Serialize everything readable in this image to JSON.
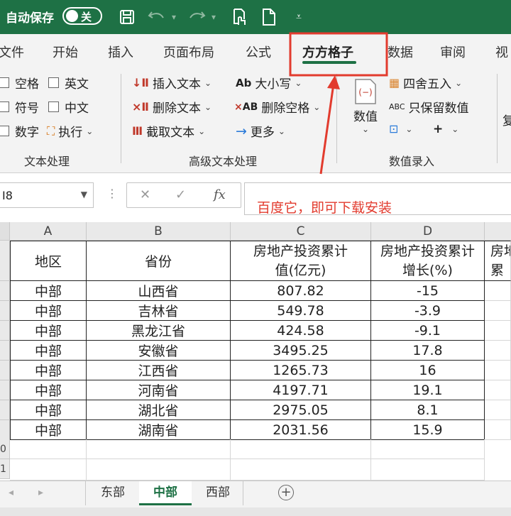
{
  "titlebar": {
    "autosave_label": "自动保存",
    "toggle_label": "关"
  },
  "tabs": [
    "文件",
    "开始",
    "插入",
    "页面布局",
    "公式",
    "方方格子",
    "数据",
    "审阅",
    "视"
  ],
  "ribbon": {
    "checkboxes": [
      "空格",
      "英文",
      "符号",
      "中文",
      "数字"
    ],
    "execute": "执行",
    "group1": "文本处理",
    "insert_text": "插入文本",
    "delete_text": "删除文本",
    "extract_text": "截取文本",
    "case": "大小写",
    "delete_space": "删除空格",
    "more": "更多",
    "group2": "高级文本处理",
    "value_btn": "数值",
    "round": "四舍五入",
    "keep_value": "只保留数值",
    "group3": "数值录入",
    "right_cut": "复"
  },
  "formula_bar": {
    "namebox": "I8",
    "fx": "fx"
  },
  "annotation": {
    "text": "百度它，即可下载安装",
    "color": "#e23b2e"
  },
  "columns": [
    "A",
    "B",
    "C",
    "D"
  ],
  "row_numbers": [
    "0",
    "1"
  ],
  "header": {
    "region": "地区",
    "province": "省份",
    "c": "房地产投资累计值(亿元)",
    "d": "房地产投资累计增长(%)",
    "e": "房地",
    "e2": "累"
  },
  "rows": [
    {
      "region": "中部",
      "province": "山西省",
      "value": "807.82",
      "growth": "-15"
    },
    {
      "region": "中部",
      "province": "吉林省",
      "value": "549.78",
      "growth": "-3.9"
    },
    {
      "region": "中部",
      "province": "黑龙江省",
      "value": "424.58",
      "growth": "-9.1"
    },
    {
      "region": "中部",
      "province": "安徽省",
      "value": "3495.25",
      "growth": "17.8"
    },
    {
      "region": "中部",
      "province": "江西省",
      "value": "1265.73",
      "growth": "16"
    },
    {
      "region": "中部",
      "province": "河南省",
      "value": "4197.71",
      "growth": "19.1"
    },
    {
      "region": "中部",
      "province": "湖北省",
      "value": "2975.05",
      "growth": "8.1"
    },
    {
      "region": "中部",
      "province": "湖南省",
      "value": "2031.56",
      "growth": "15.9"
    }
  ],
  "sheets": [
    "东部",
    "中部",
    "西部"
  ],
  "active_sheet": "中部",
  "colors": {
    "accent": "#1e7145",
    "highlight_box": "#e23b2e"
  }
}
